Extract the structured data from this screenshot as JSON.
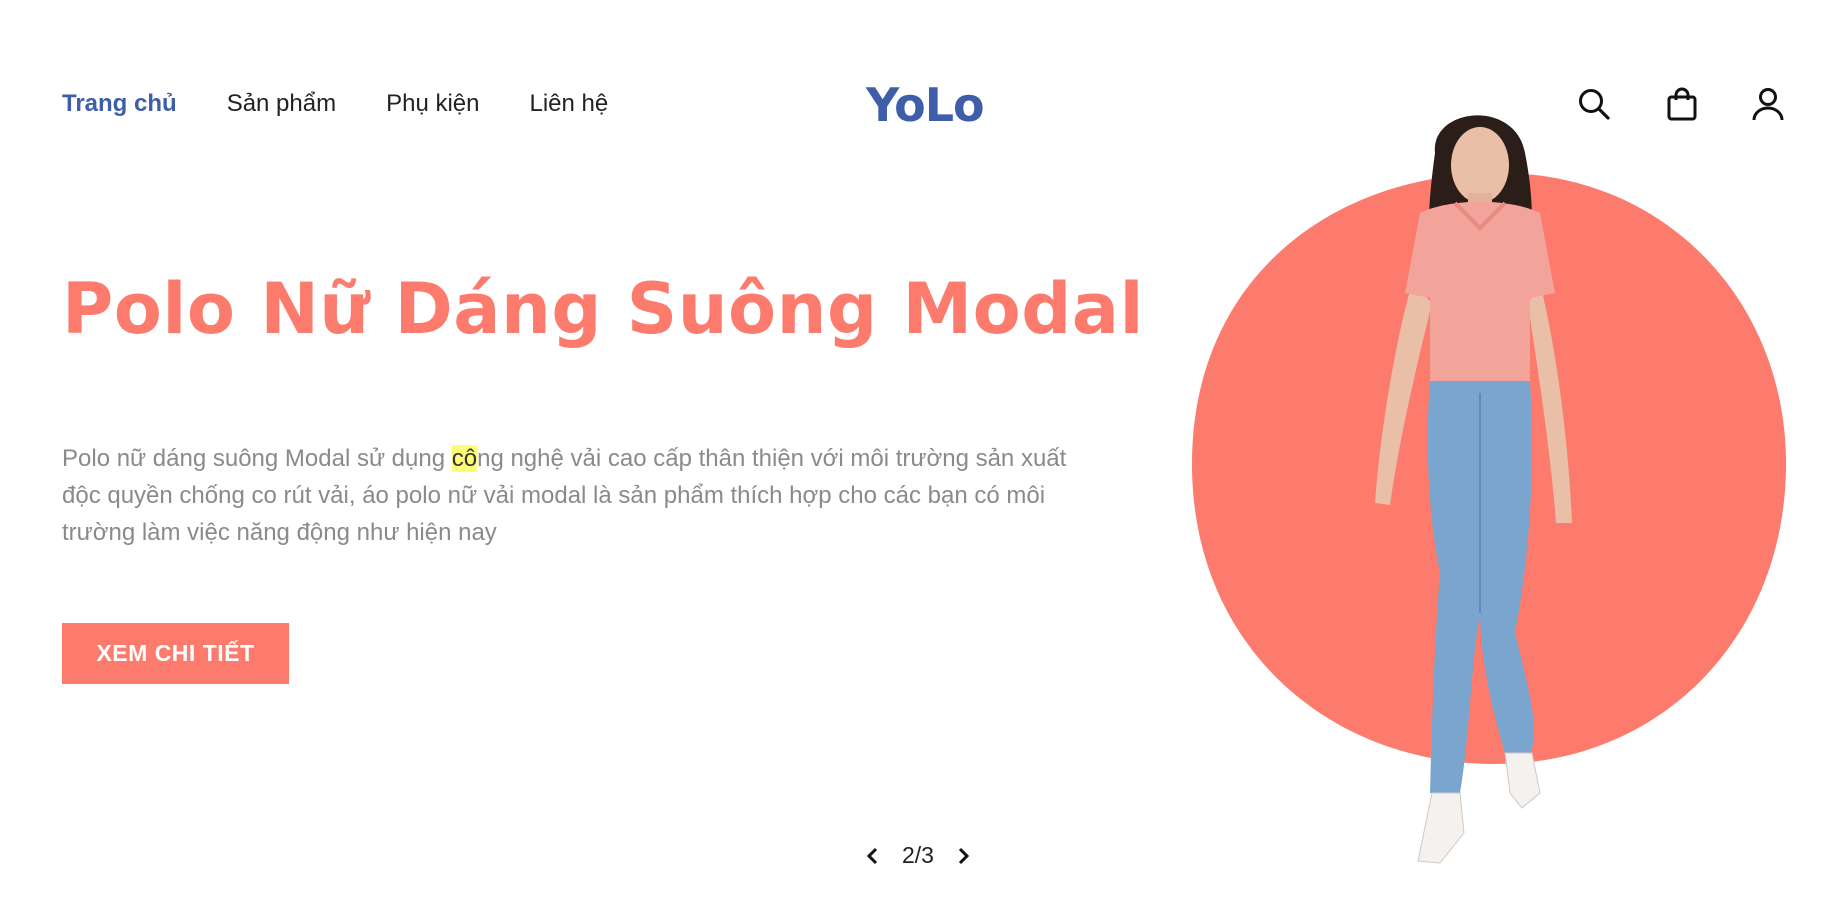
{
  "nav": {
    "items": [
      {
        "label": "Trang chủ",
        "active": true
      },
      {
        "label": "Sản phẩm",
        "active": false
      },
      {
        "label": "Phụ kiện",
        "active": false
      },
      {
        "label": "Liên hệ",
        "active": false
      }
    ]
  },
  "logo": "YoLo",
  "header_icons": [
    "search-icon",
    "shopping-bag-icon",
    "user-icon"
  ],
  "hero": {
    "title": "Polo Nữ Dáng Suông Modal",
    "description_before": "Polo nữ dáng suông Modal sử dụng ",
    "description_highlight": "cô",
    "description_after": "ng nghệ vải cao cấp thân thiện với môi trường sản xuất độc quyền chống co rút vải, áo polo nữ vải modal là sản phẩm thích hợp cho các bạn có môi trường làm việc năng động như hiện nay",
    "cta_label": "XEM CHI TIẾT"
  },
  "pager": {
    "text": "2/3",
    "prev_icon": "chevron-left-icon",
    "next_icon": "chevron-right-icon"
  },
  "colors": {
    "accent": "#fc7b6d",
    "brand": "#3f5eaa",
    "body_text": "#8a8a8a",
    "highlight": "#fdfd77"
  }
}
